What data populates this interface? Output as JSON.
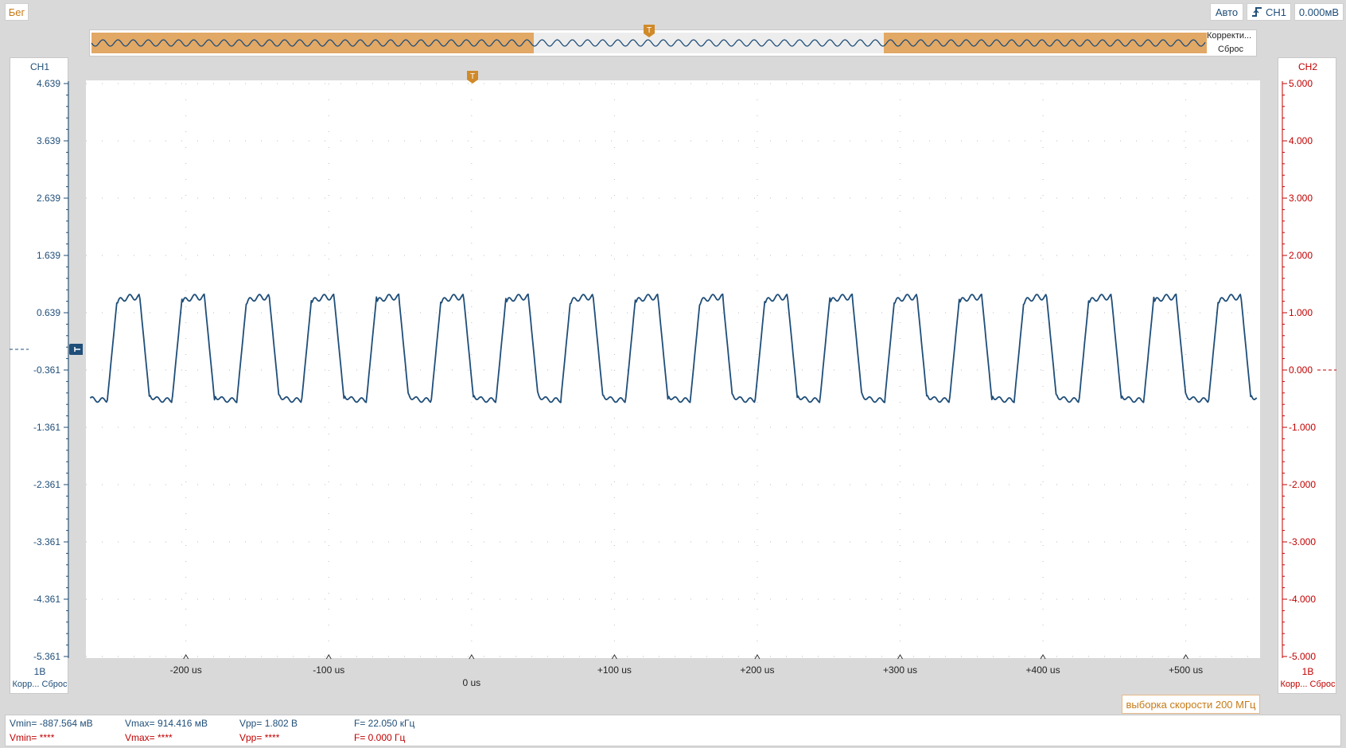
{
  "toolbar": {
    "run_label": "Бег",
    "mode_label": "Авто",
    "trigger_source": "CH1",
    "trigger_level": "0.000мВ"
  },
  "overview": {
    "correct_label": "Корректи...",
    "reset_label": "Сброс",
    "trigger_marker": "T"
  },
  "plot": {
    "trigger_marker": "T"
  },
  "ch1": {
    "title": "CH1",
    "scale": "1В",
    "corr_label": "Корр...",
    "reset_label": "Сброс",
    "color": "#1f4e79",
    "y_ticks": [
      "4.639",
      "3.639",
      "2.639",
      "1.639",
      "0.639",
      "-0.361",
      "-1.361",
      "-2.361",
      "-3.361",
      "-4.361",
      "-5.361"
    ]
  },
  "ch2": {
    "title": "CH2",
    "scale": "1В",
    "corr_label": "Корр...",
    "reset_label": "Сброс",
    "color": "#c00000",
    "y_ticks": [
      "5.000",
      "4.000",
      "3.000",
      "2.000",
      "1.000",
      "0.000",
      "-1.000",
      "-2.000",
      "-3.000",
      "-4.000",
      "-5.000"
    ]
  },
  "x_axis": {
    "ticks": [
      "-200 us",
      "-100 us",
      "0 us",
      "+100 us",
      "+200 us",
      "+300 us",
      "+400 us",
      "+500 us"
    ]
  },
  "sample_rate_label": "выборка скорости 200 МГц",
  "measurements": {
    "ch1": {
      "vmin": "Vmin= -887.564 мВ",
      "vmax": "Vmax= 914.416 мВ",
      "vpp": "Vpp= 1.802 В",
      "freq": "F= 22.050 кГц"
    },
    "ch2": {
      "vmin": "Vmin= ****",
      "vmax": "Vmax= ****",
      "vpp": "Vpp= ****",
      "freq": "F= 0.000 Гц"
    }
  },
  "chart_data": {
    "type": "line",
    "x_unit": "us",
    "xlim": [
      -270,
      552
    ],
    "ylim": [
      -5.361,
      4.639
    ],
    "series": [
      {
        "name": "CH1",
        "frequency_khz": 22.05,
        "vmin": -0.888,
        "vmax": 0.914,
        "first_rise_us": -255
      }
    ]
  }
}
